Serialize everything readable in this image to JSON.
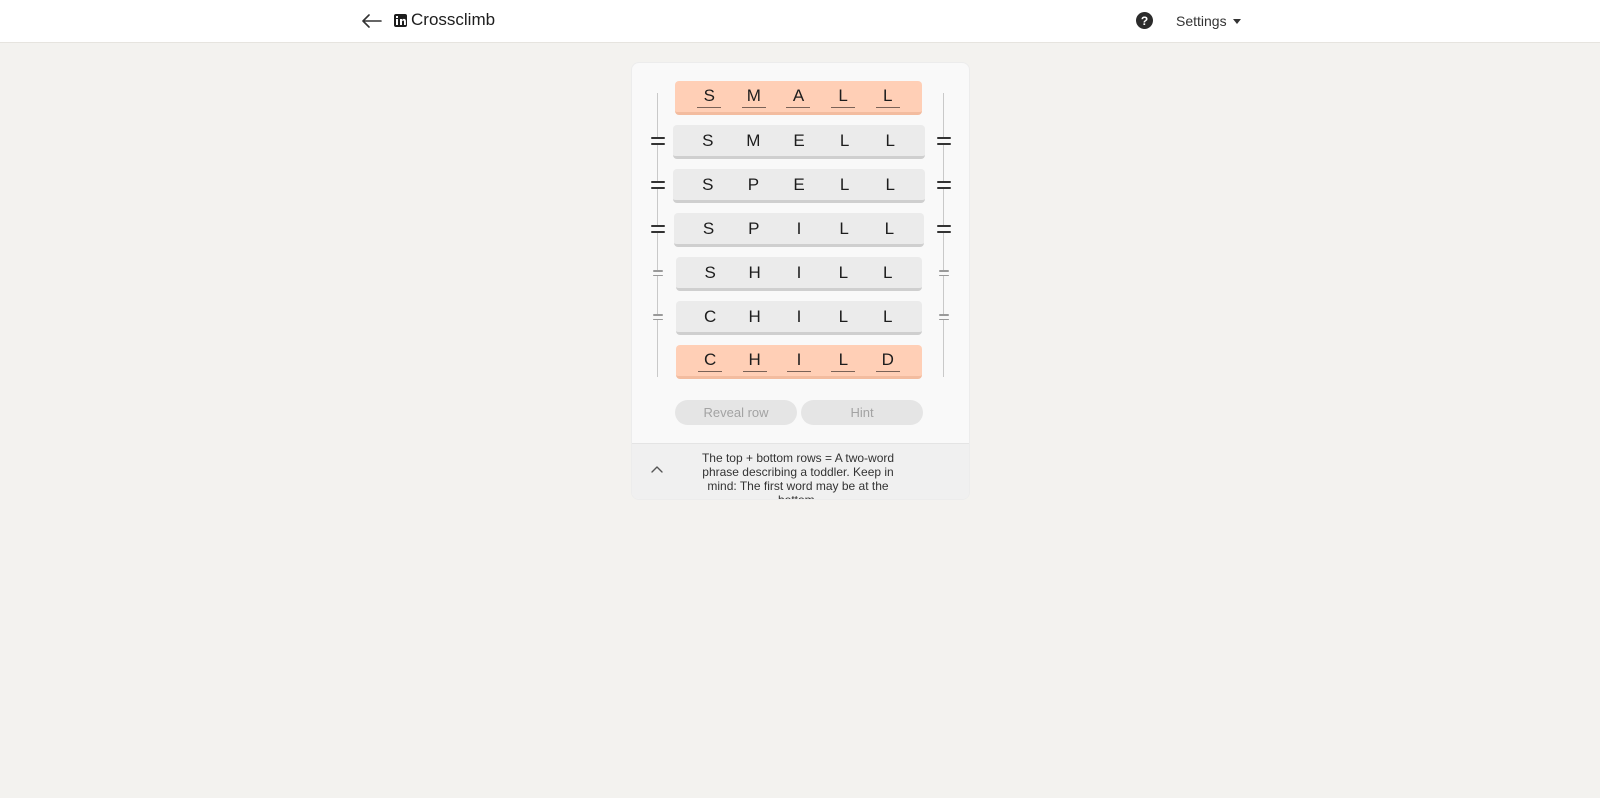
{
  "header": {
    "title": "Crossclimb",
    "help_icon": "?",
    "settings_label": "Settings"
  },
  "puzzle": {
    "rows": [
      {
        "letters": [
          "S",
          "M",
          "A",
          "L",
          "L"
        ],
        "locked": true
      },
      {
        "letters": [
          "S",
          "M",
          "E",
          "L",
          "L"
        ],
        "locked": false
      },
      {
        "letters": [
          "S",
          "P",
          "E",
          "L",
          "L"
        ],
        "locked": false
      },
      {
        "letters": [
          "S",
          "P",
          "I",
          "L",
          "L"
        ],
        "locked": false
      },
      {
        "letters": [
          "S",
          "H",
          "I",
          "L",
          "L"
        ],
        "locked": false
      },
      {
        "letters": [
          "C",
          "H",
          "I",
          "L",
          "L"
        ],
        "locked": false
      },
      {
        "letters": [
          "C",
          "H",
          "I",
          "L",
          "D"
        ],
        "locked": true
      }
    ]
  },
  "actions": {
    "reveal_row_label": "Reveal row",
    "hint_label": "Hint"
  },
  "clue": {
    "text": "The top + bottom rows = A two-word phrase describing a toddler. Keep in mind: The first word may be at the bottom."
  },
  "colors": {
    "locked_row": "#ffcfb6",
    "row": "#ebebeb",
    "background": "#f3f2ef"
  }
}
